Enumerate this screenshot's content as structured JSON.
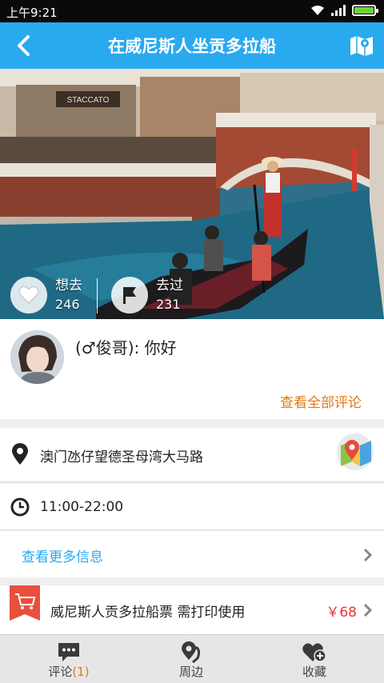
{
  "status_bar": {
    "time": "上午9:21",
    "battery_level": 1.0
  },
  "header": {
    "title": "在威尼斯人坐贡多拉船",
    "back_icon": "back-arrow-icon",
    "map_icon": "map-icon"
  },
  "hero": {
    "image": "venetian-gondola-photo",
    "want_to_go": {
      "label": "想去",
      "count": "246",
      "icon": "heart-icon"
    },
    "been_there": {
      "label": "去过",
      "count": "231",
      "icon": "flag-icon"
    }
  },
  "comment": {
    "text": "(♂俊哥): 你好",
    "view_all_label": "查看全部评论",
    "accent_color": "#e07a12"
  },
  "address": {
    "text": "澳门氹仔望德圣母湾大马路",
    "icon": "location-pin-icon",
    "nav_icon": "map-navigation-icon"
  },
  "hours": {
    "text": "11:00-22:00",
    "icon": "clock-icon"
  },
  "more_info": {
    "label": "查看更多信息",
    "color": "#29a9ee"
  },
  "ticket": {
    "title": "威尼斯人贡多拉船票 需打印使用",
    "price": "￥68",
    "icon": "cart-icon",
    "price_color": "#e53935"
  },
  "tabs": [
    {
      "label": "评论",
      "count": "(1)",
      "icon": "comment-icon"
    },
    {
      "label": "周边",
      "icon": "nearby-icon"
    },
    {
      "label": "收藏",
      "icon": "favorite-add-icon"
    }
  ],
  "colors": {
    "primary": "#29a9ee",
    "accent": "#e07a12",
    "ticket_red": "#e8503d"
  }
}
